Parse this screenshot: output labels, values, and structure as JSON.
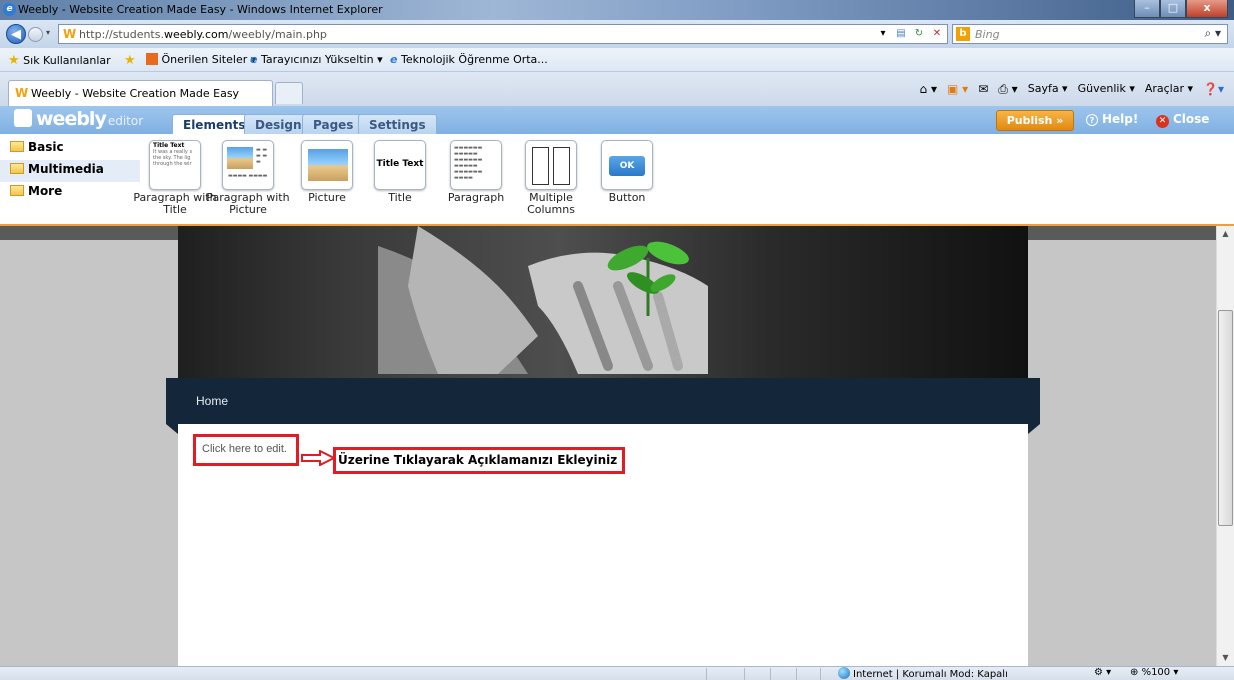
{
  "window": {
    "title": "Weebly - Website Creation Made Easy - Windows Internet Explorer",
    "min": "–",
    "max": "□",
    "close": "x"
  },
  "address": {
    "url_prefix": "http://students.",
    "url_domain": "weebly.com",
    "url_suffix": "/weebly/main.php",
    "search_placeholder": "Bing"
  },
  "favorites": {
    "label": "Sık Kullanılanlar",
    "items": [
      "Önerilen Siteler ▾",
      "Tarayıcınızı Yükseltin ▾",
      "Teknolojik Öğrenme Orta..."
    ]
  },
  "tab": {
    "title": "Weebly - Website Creation Made Easy"
  },
  "commandbar": {
    "page": "Sayfa ▾",
    "security": "Güvenlik ▾",
    "tools": "Araçlar ▾"
  },
  "weebly": {
    "logo": "weebly",
    "logo_suffix": "editor",
    "tabs": [
      "Elements",
      "Design",
      "Pages",
      "Settings"
    ],
    "publish": "Publish »",
    "help": "Help!",
    "close": "Close"
  },
  "categories": [
    "Basic",
    "Multimedia",
    "More"
  ],
  "elements": [
    {
      "label": "Paragraph with Title",
      "thumb_title": "Title Text",
      "thumb_text": "It was a really s the sky. The lig through the wir"
    },
    {
      "label": "Paragraph with Picture"
    },
    {
      "label": "Picture"
    },
    {
      "label": "Title",
      "thumb_title": "Title Text"
    },
    {
      "label": "Paragraph"
    },
    {
      "label": "Multiple Columns"
    },
    {
      "label": "Button",
      "thumb_title": "OK"
    }
  ],
  "site": {
    "nav_home": "Home",
    "edit_placeholder": "Click here to edit.",
    "annotation": "Üzerine Tıklayarak Açıklamanızı Ekleyiniz"
  },
  "status": {
    "zone": "Internet | Korumalı Mod: Kapalı",
    "zoom": "%100"
  },
  "colors": {
    "accent": "#7fb0e3",
    "publish": "#e08a12",
    "annotation_red": "#e21b24",
    "site_nav": "#14263a"
  }
}
